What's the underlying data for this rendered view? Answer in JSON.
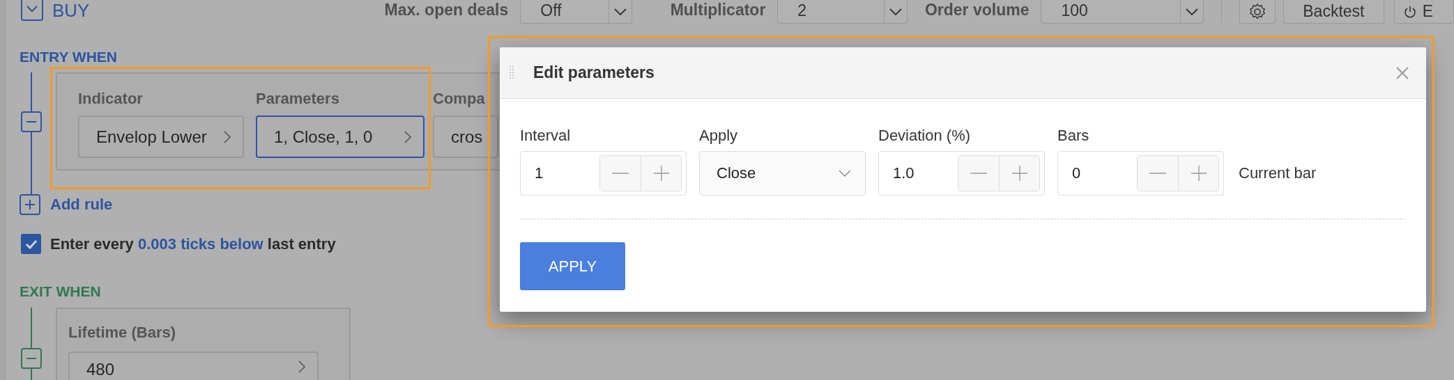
{
  "toolbar": {
    "side_label": "BUY",
    "selects": [
      {
        "label": "Max. open deals",
        "value": "Off"
      },
      {
        "label": "Multiplicator",
        "value": "2"
      },
      {
        "label": "Order volume",
        "value": "100"
      }
    ],
    "buttons": [
      {
        "kind": "settings"
      },
      {
        "kind": "text",
        "label": "Backtest"
      },
      {
        "kind": "power",
        "label": "E"
      }
    ]
  },
  "entry": {
    "title": "ENTRY WHEN",
    "columns": [
      {
        "label": "Indicator",
        "value": "Envelop Lower",
        "selected": false
      },
      {
        "label": "Parameters",
        "value": "1, Close, 1, 0",
        "selected": true
      },
      {
        "label": "Compa",
        "value": "cros",
        "selected": false
      }
    ],
    "add_rule": "Add rule",
    "repeat": {
      "checked": true,
      "before": "Enter every",
      "link": "0.003 ticks below",
      "after": "last entry"
    }
  },
  "exit": {
    "title": "EXIT WHEN",
    "rule": {
      "label": "Lifetime (Bars)",
      "value": "480"
    }
  },
  "dialog": {
    "title": "Edit parameters",
    "fields": [
      {
        "kind": "stepper",
        "label": "Interval",
        "value": "1"
      },
      {
        "kind": "select",
        "label": "Apply",
        "value": "Close"
      },
      {
        "kind": "stepper",
        "label": "Deviation (%)",
        "value": "1.0"
      },
      {
        "kind": "stepper",
        "label": "Bars",
        "value": "0",
        "note": "Current bar"
      }
    ],
    "apply": "APPLY"
  }
}
